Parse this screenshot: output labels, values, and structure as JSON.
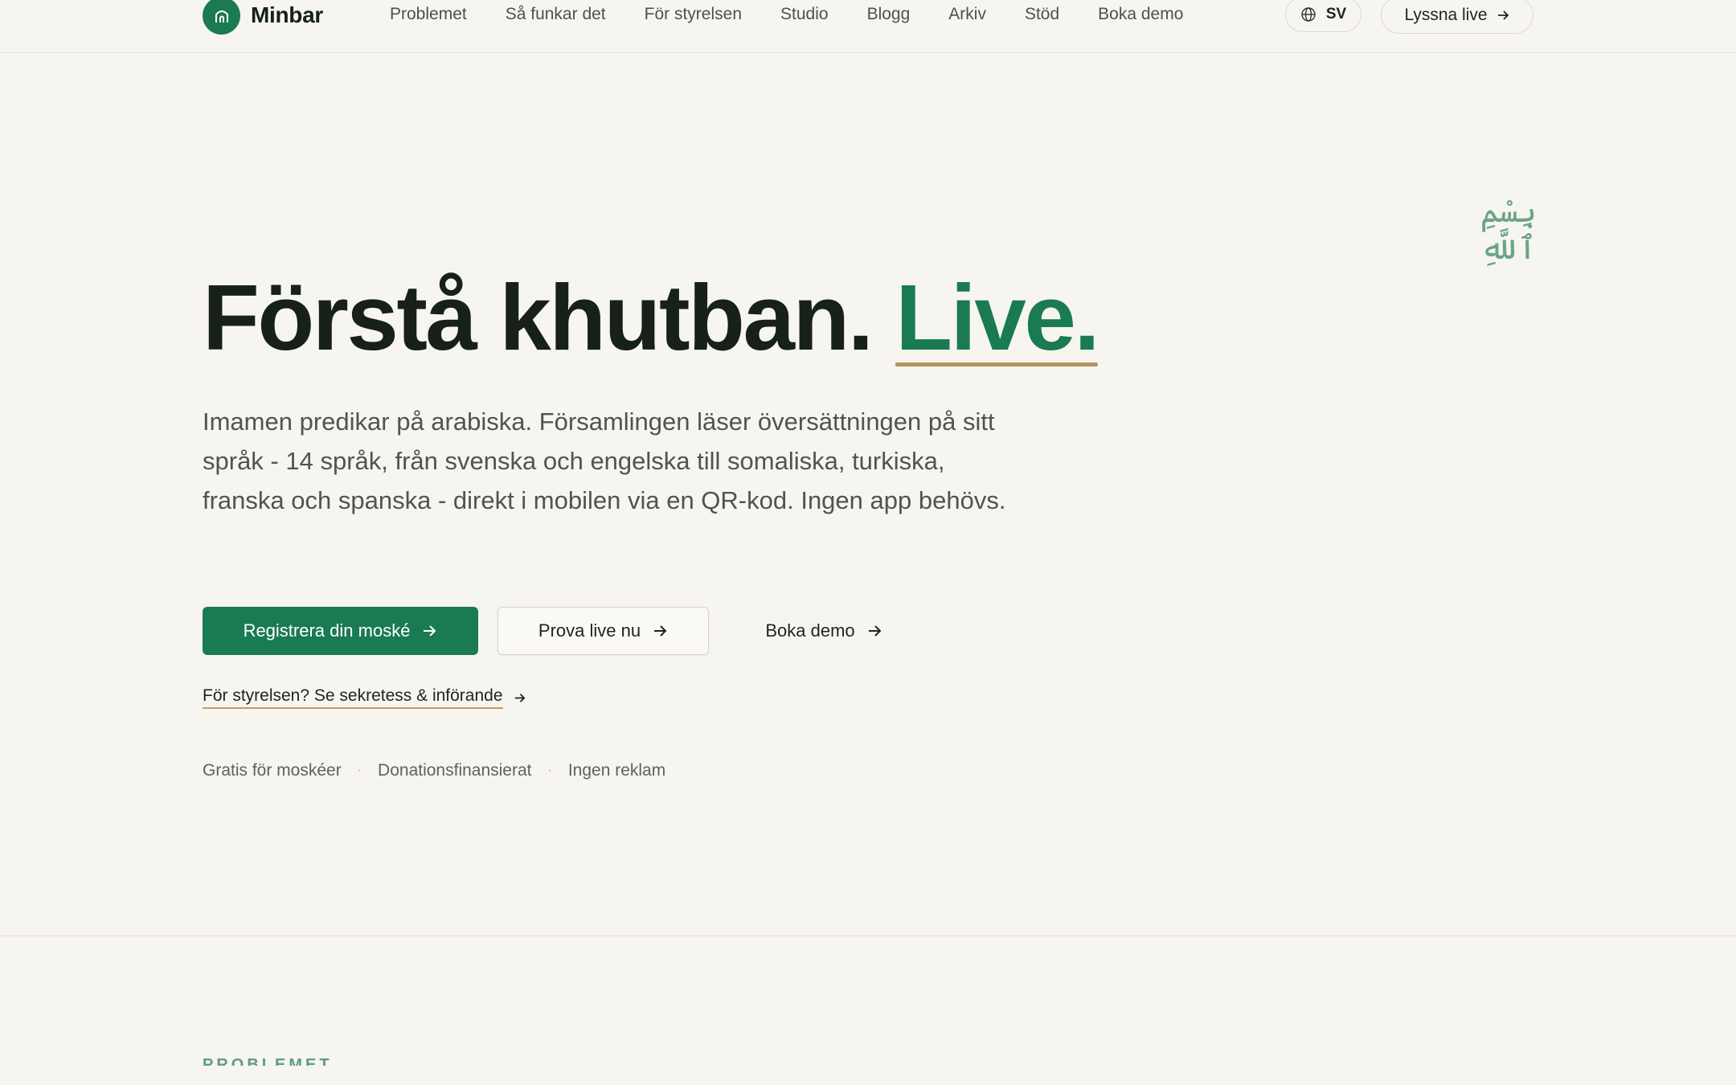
{
  "brand": {
    "name": "Minbar",
    "logo_icon": "mosque-door-icon",
    "accent_color": "#1a7a52",
    "underline_color": "#b8955e"
  },
  "nav": {
    "items": [
      {
        "label": "Problemet"
      },
      {
        "label": "Så funkar det"
      },
      {
        "label": "För styrelsen"
      },
      {
        "label": "Studio"
      },
      {
        "label": "Blogg"
      },
      {
        "label": "Arkiv"
      },
      {
        "label": "Stöd"
      },
      {
        "label": "Boka demo"
      }
    ]
  },
  "language": {
    "code": "SV",
    "icon": "globe-icon"
  },
  "listen_live": {
    "label": "Lyssna live",
    "icon": "arrow-right-icon"
  },
  "bismillah": "بِسْمِ ٱللَّهِ",
  "hero": {
    "title_main": "Förstå khutban.",
    "title_accent": "Live.",
    "description": "Imamen predikar på arabiska. Församlingen läser översättningen på sitt språk - 14 språk, från svenska och engelska till somaliska, turkiska, franska och spanska - direkt i mobilen via en QR-kod. Ingen app behövs."
  },
  "cta": {
    "primary": "Registrera din moské",
    "secondary": "Prova live nu",
    "ghost": "Boka demo",
    "board_link": "För styrelsen? Se sekretess & införande"
  },
  "features": [
    "Gratis för moskéer",
    "Donationsfinansierat",
    "Ingen reklam"
  ],
  "separator": "·",
  "next_section": {
    "label": "PROBLEMET"
  }
}
